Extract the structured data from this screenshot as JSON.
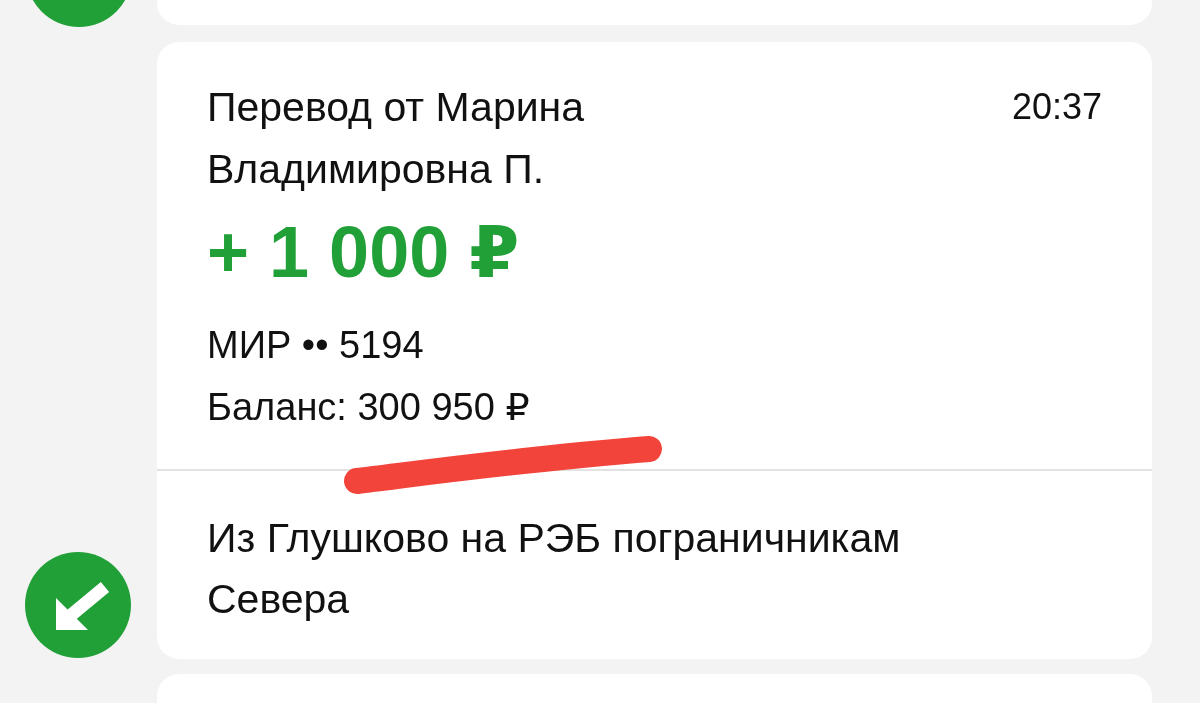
{
  "operation": {
    "kind": "incoming",
    "title": "Перевод от Марина Владимировна П.",
    "time": "20:37",
    "amount": "+ 1 000 ₽",
    "card": "МИР •• 5194",
    "balance": "Баланс: 300 950 ₽",
    "message": "Из Глушково на РЭБ пограничникам Севера"
  }
}
